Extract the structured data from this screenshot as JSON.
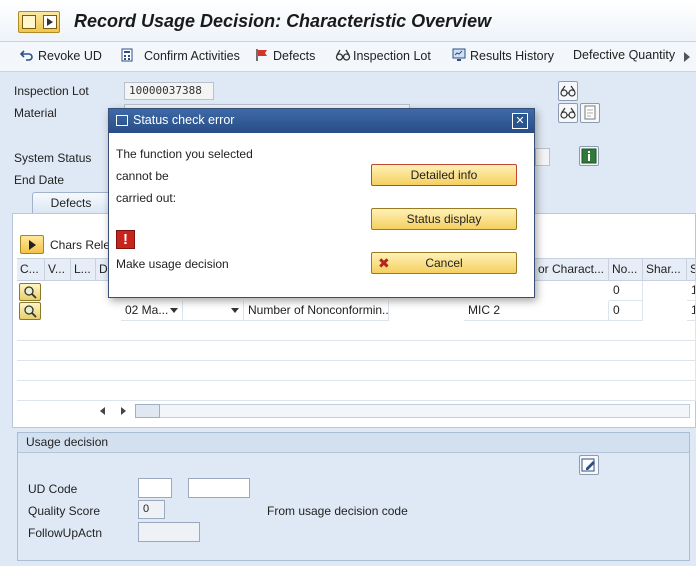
{
  "window": {
    "title": "Record Usage Decision: Characteristic Overview"
  },
  "toolbar": {
    "revoke_ud": "Revoke UD",
    "confirm_activities": "Confirm Activities",
    "defects": "Defects",
    "inspection_lot": "Inspection Lot",
    "results_history": "Results History",
    "defective_quantity": "Defective Quantity"
  },
  "header": {
    "inspection_lot_label": "Inspection Lot",
    "inspection_lot_value": "10000037388",
    "material_label": "Material",
    "system_status_label": "System Status",
    "end_date_label": "End Date"
  },
  "tabs": {
    "defects": "Defects"
  },
  "grid": {
    "chars_relevant_label": "Chars Relev",
    "columns": [
      "C...",
      "V...",
      "L...",
      "D",
      "",
      "",
      "",
      "",
      "or Charact...",
      "No...",
      "Shar...",
      "S"
    ],
    "rows": [
      {
        "seq": "",
        "mic": "",
        "no": "0",
        "s": "1"
      },
      {
        "seq": "02 Ma...",
        "desc": "Number of Nonconformin...",
        "mic": "MIC 2",
        "no": "0",
        "s": "1"
      }
    ]
  },
  "usage_decision": {
    "group_title": "Usage decision",
    "ud_code_label": "UD Code",
    "ud_code_value": "",
    "ud_code_text": "",
    "quality_score_label": "Quality Score",
    "quality_score_value": "0",
    "quality_score_note": "From usage decision code",
    "followup_label": "FollowUpActn",
    "followup_value": ""
  },
  "dialog": {
    "title": "Status check error",
    "message_line1": "The function you selected",
    "message_line2": "cannot be",
    "message_line3": "carried out:",
    "detail": "Make usage decision",
    "detailed_info_button": "Detailed info",
    "status_display_button": "Status display",
    "cancel_button": "Cancel",
    "close_glyph": "✕",
    "error_glyph": "!"
  },
  "colors": {
    "background": "#dfe9f5",
    "dialog_title": "#274d86",
    "button_yellow": "#f4d060",
    "error_red": "#c8231c"
  }
}
